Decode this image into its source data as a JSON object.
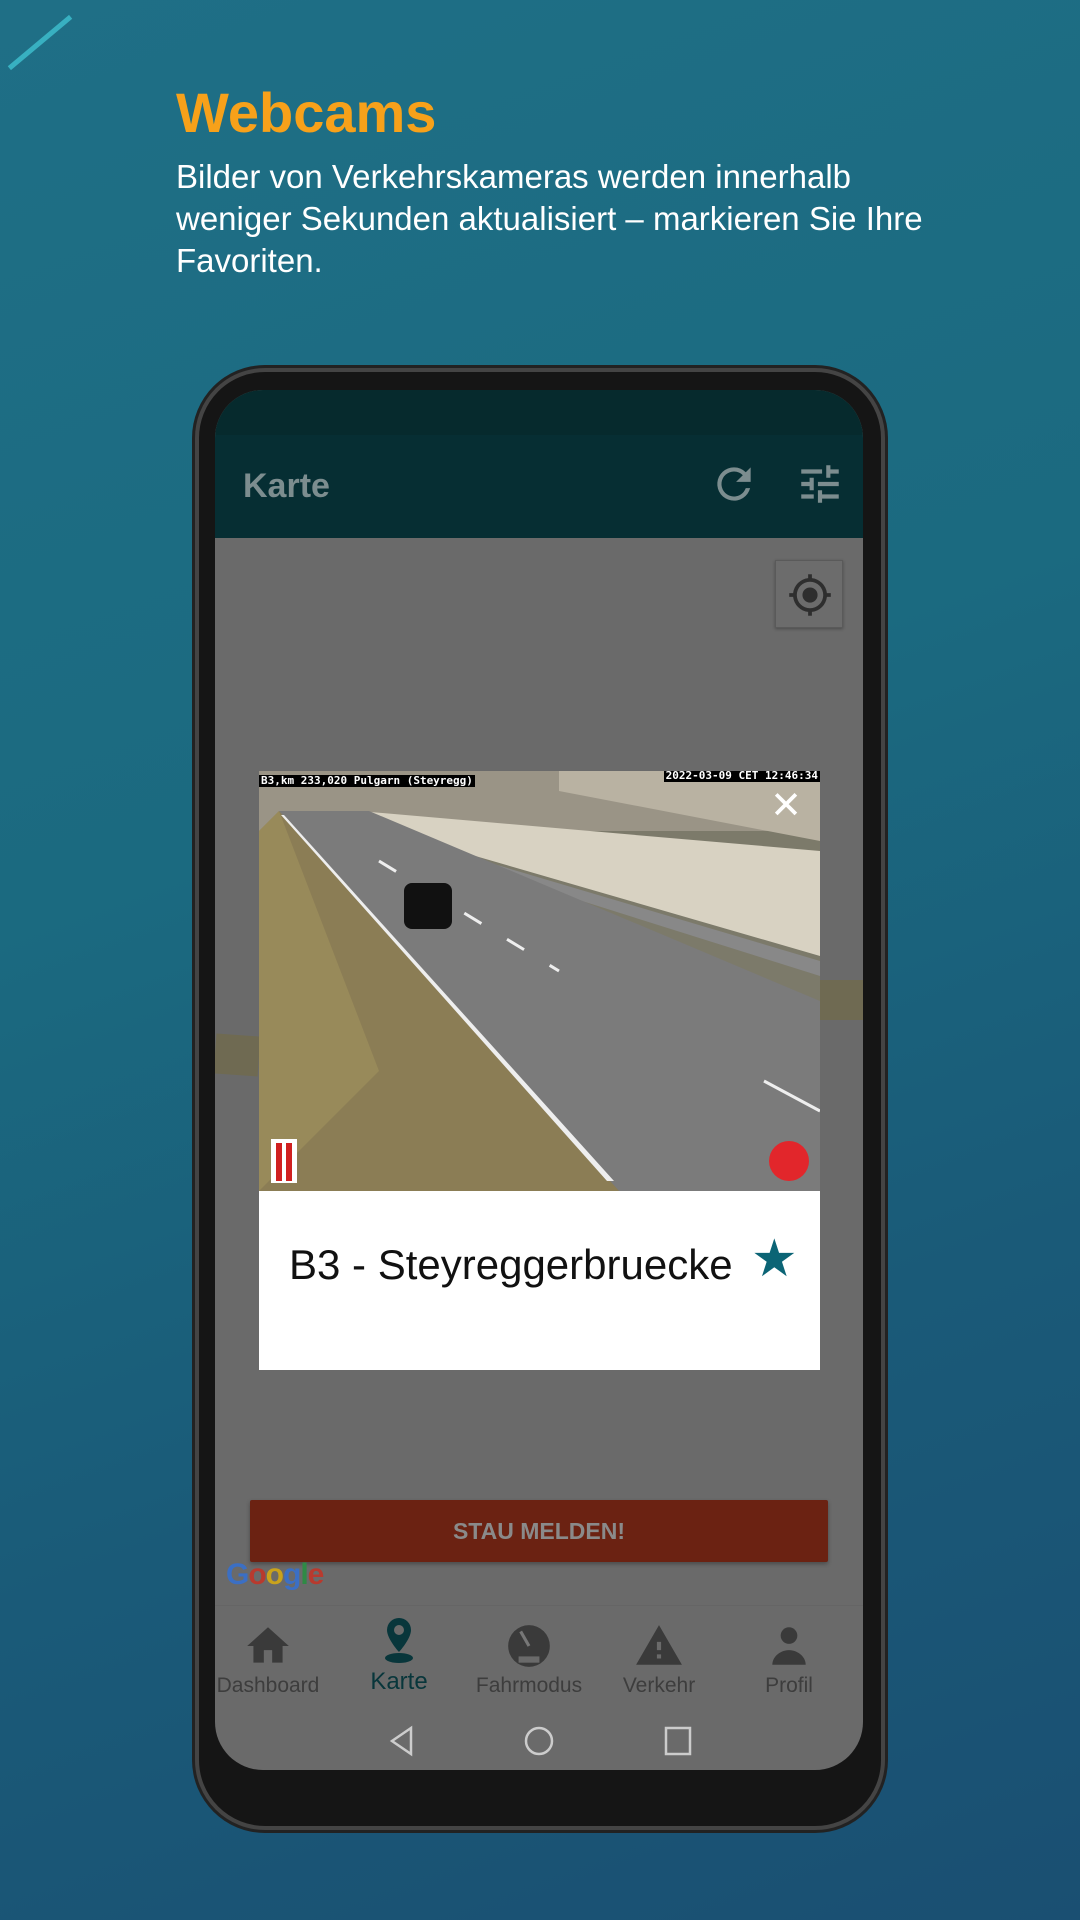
{
  "promo": {
    "title": "Webcams",
    "subtitle": "Bilder von Verkehrskameras werden innerhalb weniger Sekunden aktualisiert – markieren Sie Ihre Favoriten."
  },
  "appbar": {
    "title": "Karte",
    "icons": [
      "refresh-icon",
      "filter-sliders-icon"
    ]
  },
  "map": {
    "locate_icon": "my-location-icon",
    "attribution": "Google"
  },
  "webcam_dialog": {
    "osd_location": "B3,km 233,020 Pulgarn (Steyregg)",
    "osd_timestamp": "2022-03-09 CET 12:46:34",
    "name": "B3 - Steyreggerbruecke",
    "favorite": true,
    "star_color": "#0b6475"
  },
  "report_button": "STAU MELDEN!",
  "bottom_nav": {
    "items": [
      {
        "label": "Dashboard",
        "icon": "home-icon"
      },
      {
        "label": "Karte",
        "icon": "map-pin-icon",
        "active": true
      },
      {
        "label": "Fahrmodus",
        "icon": "speedometer-icon"
      },
      {
        "label": "Verkehr",
        "icon": "warning-icon"
      },
      {
        "label": "Profil",
        "icon": "person-icon"
      }
    ]
  },
  "colors": {
    "accent": "#f7a11a",
    "appbar": "#062e33",
    "report": "#6b2212"
  }
}
